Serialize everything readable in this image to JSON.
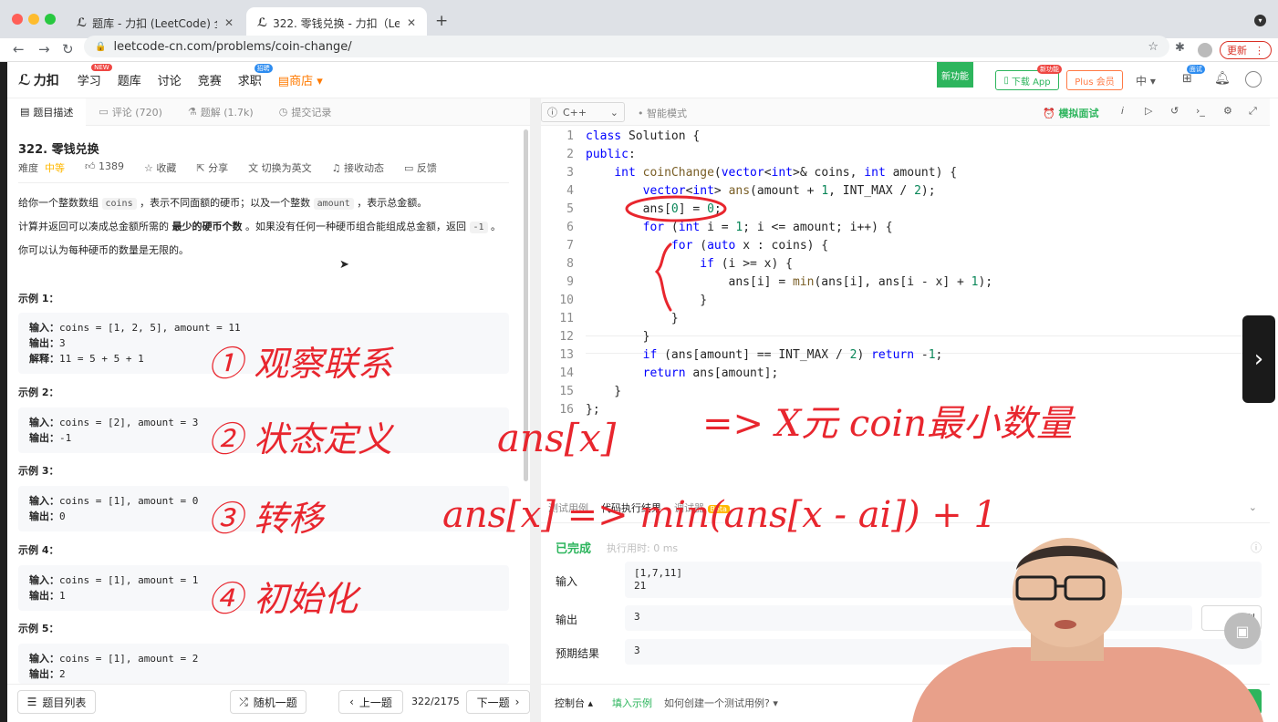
{
  "browser": {
    "tabs": [
      {
        "title": "题库 - 力扣 (LeetCode) 全球极客挚爱",
        "active": false
      },
      {
        "title": "322. 零钱兑换 - 力扣（LeetCode）",
        "active": true
      }
    ],
    "new_tab": "+",
    "url": "leetcode-cn.com/problems/coin-change/",
    "update_label": "更新"
  },
  "nav": {
    "logo": "力扣",
    "items": [
      "学习",
      "题库",
      "讨论",
      "竞赛",
      "求职",
      "商店"
    ],
    "learn_badge": "NEW",
    "job_badge": "招聘",
    "new_feature": "新功能",
    "download_app": "下载 App",
    "app_badge": "新功能",
    "plus": "Plus 会员",
    "lang": "中",
    "interview_badge": "面试"
  },
  "left_tabs": [
    {
      "label": "题目描述",
      "icon": "doc-icon"
    },
    {
      "label": "评论 (720)",
      "icon": "comment-icon"
    },
    {
      "label": "题解 (1.7k)",
      "icon": "flask-icon"
    },
    {
      "label": "提交记录",
      "icon": "history-icon"
    }
  ],
  "problem": {
    "title": "322. 零钱兑换",
    "difficulty_label": "难度",
    "difficulty": "中等",
    "likes": "1389",
    "collect": "收藏",
    "share": "分享",
    "switch_en": "切换为英文",
    "subscribe": "接收动态",
    "feedback": "反馈",
    "desc1_a": "给你一个整数数组",
    "desc1_code1": "coins",
    "desc1_b": "，表示不同面额的硬币；以及一个整数",
    "desc1_code2": "amount",
    "desc1_c": "，表示总金额。",
    "desc2_a": "计算并返回可以凑成总金额所需的",
    "desc2_bold": "最少的硬币个数",
    "desc2_b": "。如果没有任何一种硬币组合能组成总金额，返回",
    "desc2_code": "-1",
    "desc2_c": "。",
    "desc3": "你可以认为每种硬币的数量是无限的。",
    "examples": [
      {
        "h": "示例 1：",
        "in_label": "输入：",
        "input": "coins = [1, 2, 5], amount = 11",
        "out_label": "输出：",
        "output": "3",
        "ex_label": "解释：",
        "explain": "11 = 5 + 5 + 1"
      },
      {
        "h": "示例 2：",
        "in_label": "输入：",
        "input": "coins = [2], amount = 3",
        "out_label": "输出：",
        "output": "-1"
      },
      {
        "h": "示例 3：",
        "in_label": "输入：",
        "input": "coins = [1], amount = 0",
        "out_label": "输出：",
        "output": "0"
      },
      {
        "h": "示例 4：",
        "in_label": "输入：",
        "input": "coins = [1], amount = 1",
        "out_label": "输出：",
        "output": "1"
      },
      {
        "h": "示例 5：",
        "in_label": "输入：",
        "input": "coins = [1], amount = 2",
        "out_label": "输出：",
        "output": "2"
      }
    ]
  },
  "left_footer": {
    "list": "题目列表",
    "random": "随机一题",
    "prev": "上一题",
    "progress": "322/2175",
    "next": "下一题"
  },
  "editor_head": {
    "lang": "C++",
    "smart": "智能模式",
    "mock": "模拟面试"
  },
  "code_lines": [
    "class Solution {",
    "public:",
    "    int coinChange(vector<int>& coins, int amount) {",
    "        vector<int> ans(amount + 1, INT_MAX / 2);",
    "        ans[0] = 0;",
    "        for (int i = 1; i <= amount; i++) {",
    "            for (auto x : coins) {",
    "                if (i >= x) {",
    "                    ans[i] = min(ans[i], ans[i - x] + 1);",
    "                }",
    "            }",
    "        }",
    "        if (ans[amount] == INT_MAX / 2) return -1;",
    "        return ans[amount];",
    "    }",
    "};"
  ],
  "result": {
    "tabs": [
      "测试用例",
      "代码执行结果",
      "调试器"
    ],
    "beta": "Beta",
    "status": "已完成",
    "time": "执行用时: 0 ms",
    "input_label": "输入",
    "input_lines": [
      "[1,7,11]",
      "21"
    ],
    "output_label": "输出",
    "output": "3",
    "expected_label": "预期结果",
    "expected": "3",
    "diff": "差别"
  },
  "right_footer": {
    "console": "控制台",
    "fill": "填入示例",
    "howto": "如何创建一个测试用例?",
    "run": "码",
    "submit": "提交"
  },
  "annotations": {
    "line1": "① 观察联系",
    "line2a": "② 状态定义",
    "line2b": "ans[x]",
    "line2c": "=> X元 coin最小数量",
    "line3a": "③ 转移",
    "line3b": "ans[x] => min(ans[x - ai]) + 1",
    "line4": "④ 初始化"
  },
  "colors": {
    "accent": "#2db55d",
    "medium": "#ffb800",
    "ink": "#e8262e",
    "plus": "#ff7a45"
  }
}
